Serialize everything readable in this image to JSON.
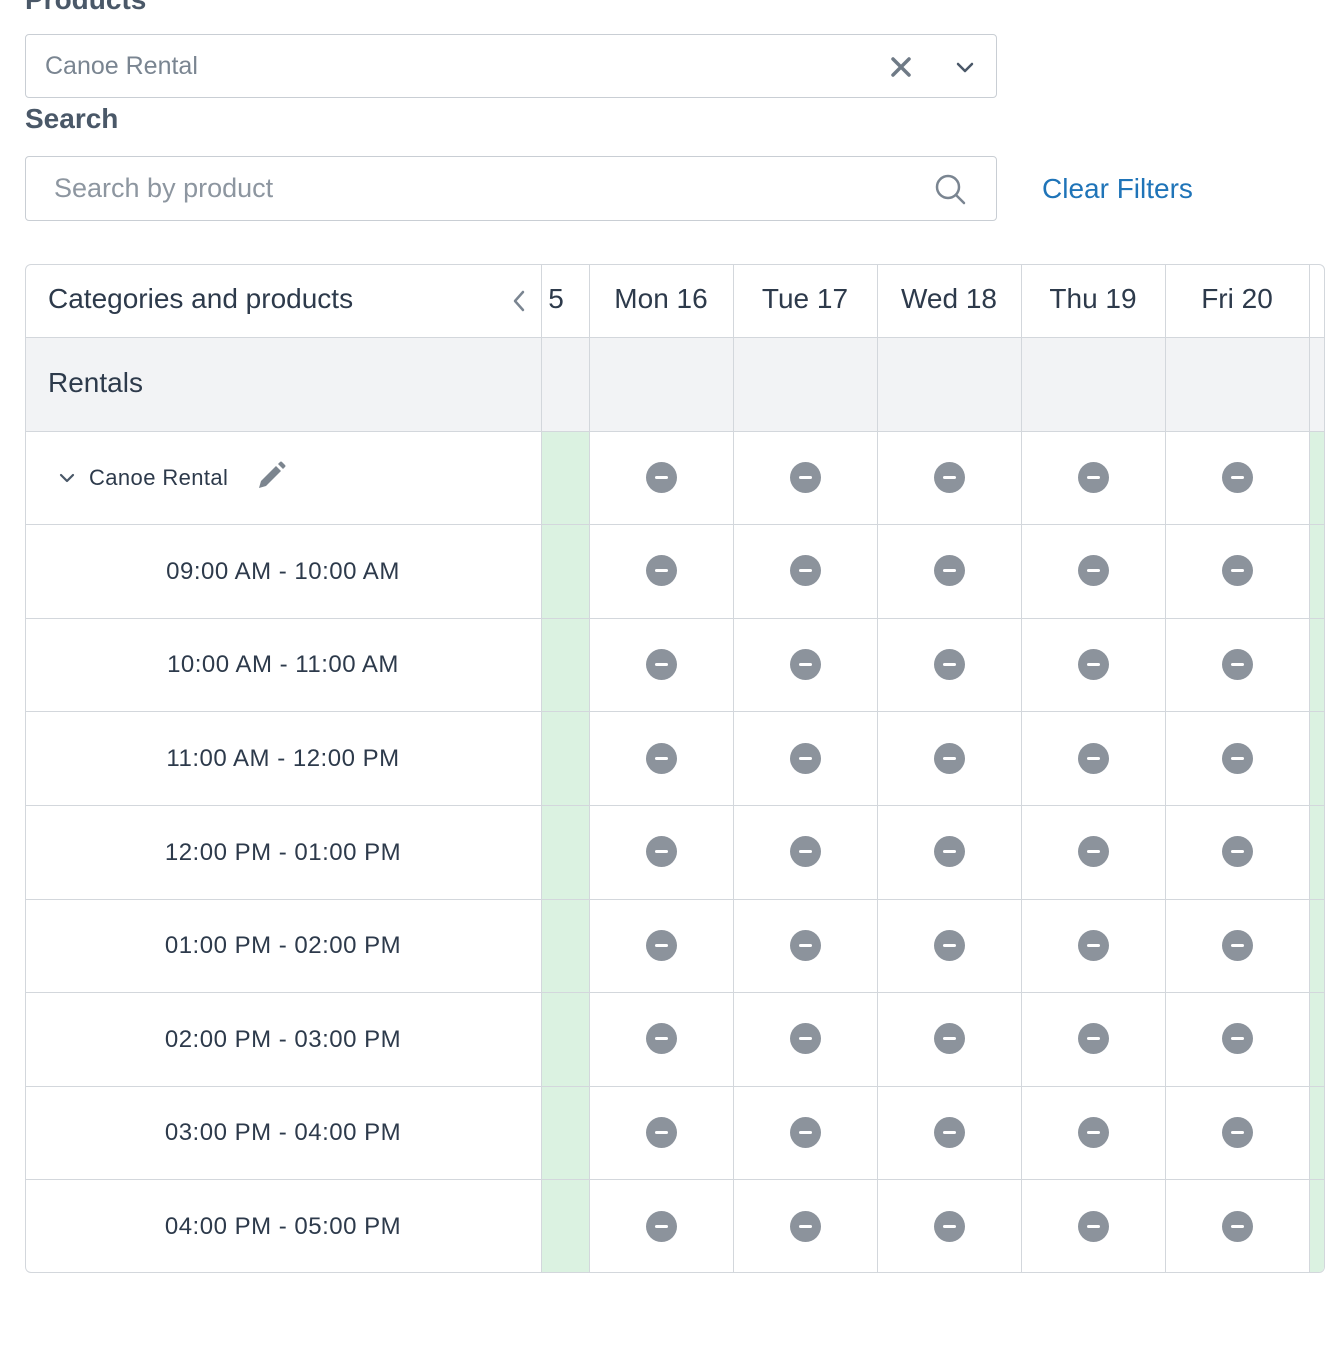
{
  "filters": {
    "products_label": "Products",
    "products_value": "Canoe Rental",
    "search_label": "Search",
    "search_placeholder": "Search by product",
    "search_value": "",
    "clear_filters": "Clear Filters"
  },
  "table": {
    "header_title": "Categories and products",
    "partial_day": "5",
    "days": [
      "Mon 16",
      "Tue 17",
      "Wed 18",
      "Thu 19",
      "Fri 20"
    ],
    "category": "Rentals",
    "product": "Canoe Rental",
    "time_slots": [
      "09:00 AM - 10:00 AM",
      "10:00 AM - 11:00 AM",
      "11:00 AM - 12:00 PM",
      "12:00 PM - 01:00 PM",
      "01:00 PM - 02:00 PM",
      "02:00 PM - 03:00 PM",
      "03:00 PM - 04:00 PM",
      "04:00 PM - 05:00 PM"
    ],
    "cell_status": "unavailable"
  },
  "colors": {
    "accent": "#1f74b8",
    "available_col": "#dbf2e1",
    "status_icon": "#8c939c"
  },
  "icons": {
    "clear": "close-icon",
    "dropdown": "chevron-down-icon",
    "search": "search-icon",
    "prev": "chevron-left-icon",
    "collapse": "chevron-down-icon",
    "edit": "pencil-icon",
    "status": "minus-circle-icon"
  }
}
